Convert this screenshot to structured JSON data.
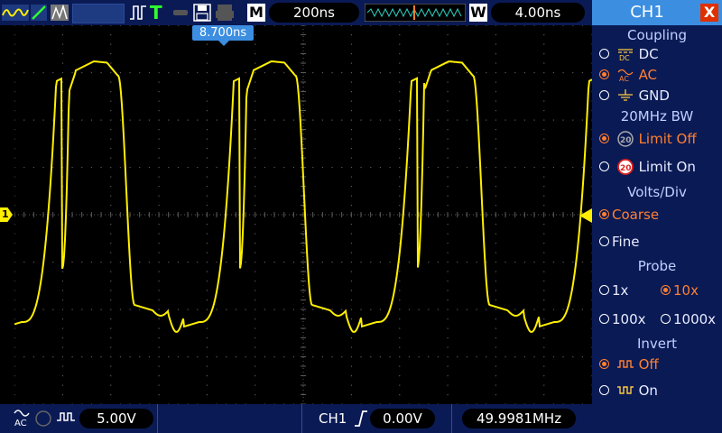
{
  "topbar": {
    "mode_label": "M",
    "timebase": "200ns",
    "window_label": "W",
    "window_timebase": "4.00ns",
    "trigger_position": "8.700ns",
    "trigger_mode_letter": "T"
  },
  "bottombar": {
    "ch1_volts": "5.00V",
    "trigger_source": "CH1",
    "trigger_level": "0.00V",
    "frequency": "49.9981MHz"
  },
  "screen": {
    "channel_marker": "1",
    "trace_color": "#ffef00",
    "grid_color": "#5a5a5a"
  },
  "menu": {
    "title": "CH1",
    "close_label": "X",
    "coupling": {
      "title": "Coupling",
      "options": [
        "DC",
        "AC",
        "GND"
      ],
      "selected": "AC"
    },
    "bandwidth": {
      "title": "20MHz BW",
      "options": [
        "Limit Off",
        "Limit On"
      ],
      "icon_label": "20",
      "selected": "Limit Off"
    },
    "volts_div": {
      "title": "Volts/Div",
      "options": [
        "Coarse",
        "Fine"
      ],
      "selected": "Coarse"
    },
    "probe": {
      "title": "Probe",
      "options": [
        "1x",
        "10x",
        "100x",
        "1000x"
      ],
      "selected": "10x"
    },
    "invert": {
      "title": "Invert",
      "options": [
        "Off",
        "On"
      ],
      "selected": "Off"
    }
  },
  "colors": {
    "bar_bg": "#0a1a55",
    "accent": "#3c8ee0",
    "selected": "#ff8030",
    "trace": "#ffef00"
  }
}
